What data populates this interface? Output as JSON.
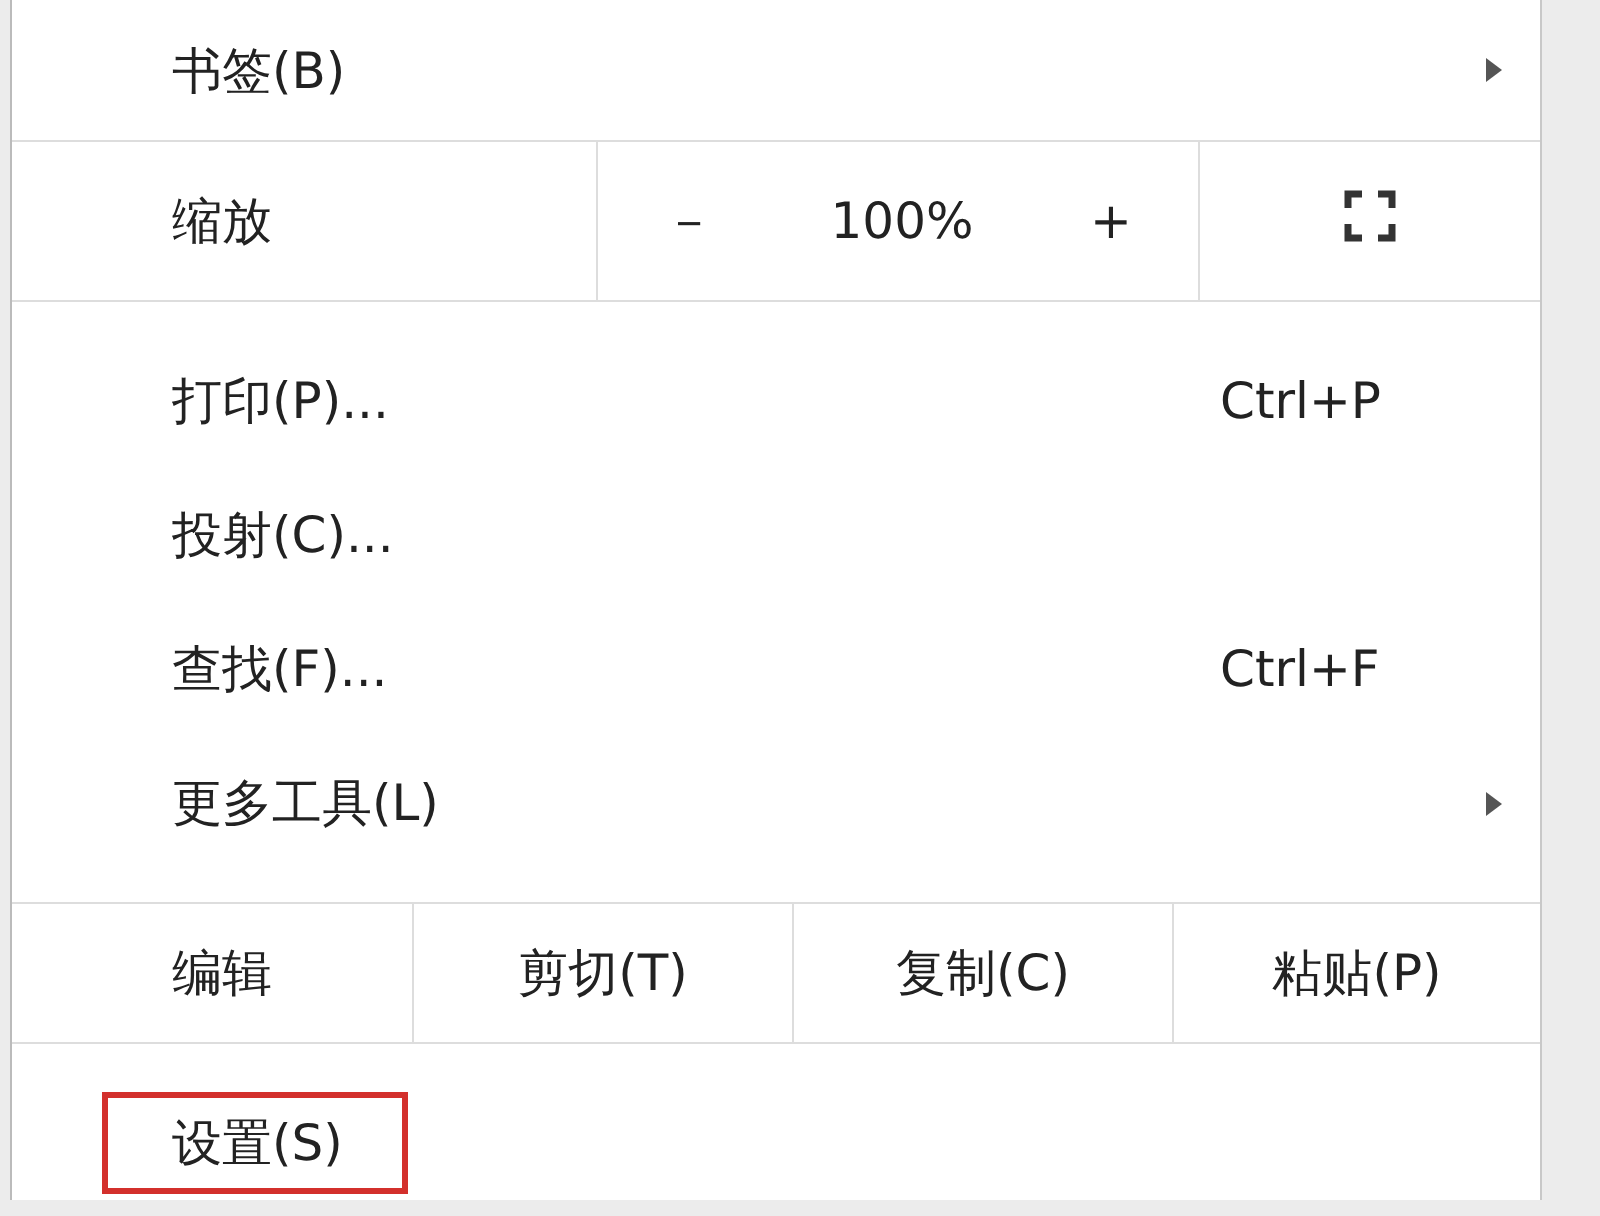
{
  "menu": {
    "items": [
      {
        "kind": "submenu",
        "label": "书签(B)"
      },
      {
        "kind": "zoom",
        "label": "缩放",
        "minus": "－",
        "value": "100%",
        "plus": "+"
      },
      {
        "kind": "item",
        "label": "打印(P)...",
        "shortcut": "Ctrl+P"
      },
      {
        "kind": "item",
        "label": "投射(C)..."
      },
      {
        "kind": "item",
        "label": "查找(F)...",
        "shortcut": "Ctrl+F"
      },
      {
        "kind": "submenu",
        "label": "更多工具(L)"
      },
      {
        "kind": "edit",
        "label": "编辑",
        "actions": [
          "剪切(T)",
          "复制(C)",
          "粘贴(P)"
        ]
      },
      {
        "kind": "item",
        "label": "设置(S)",
        "highlighted": true
      }
    ]
  }
}
